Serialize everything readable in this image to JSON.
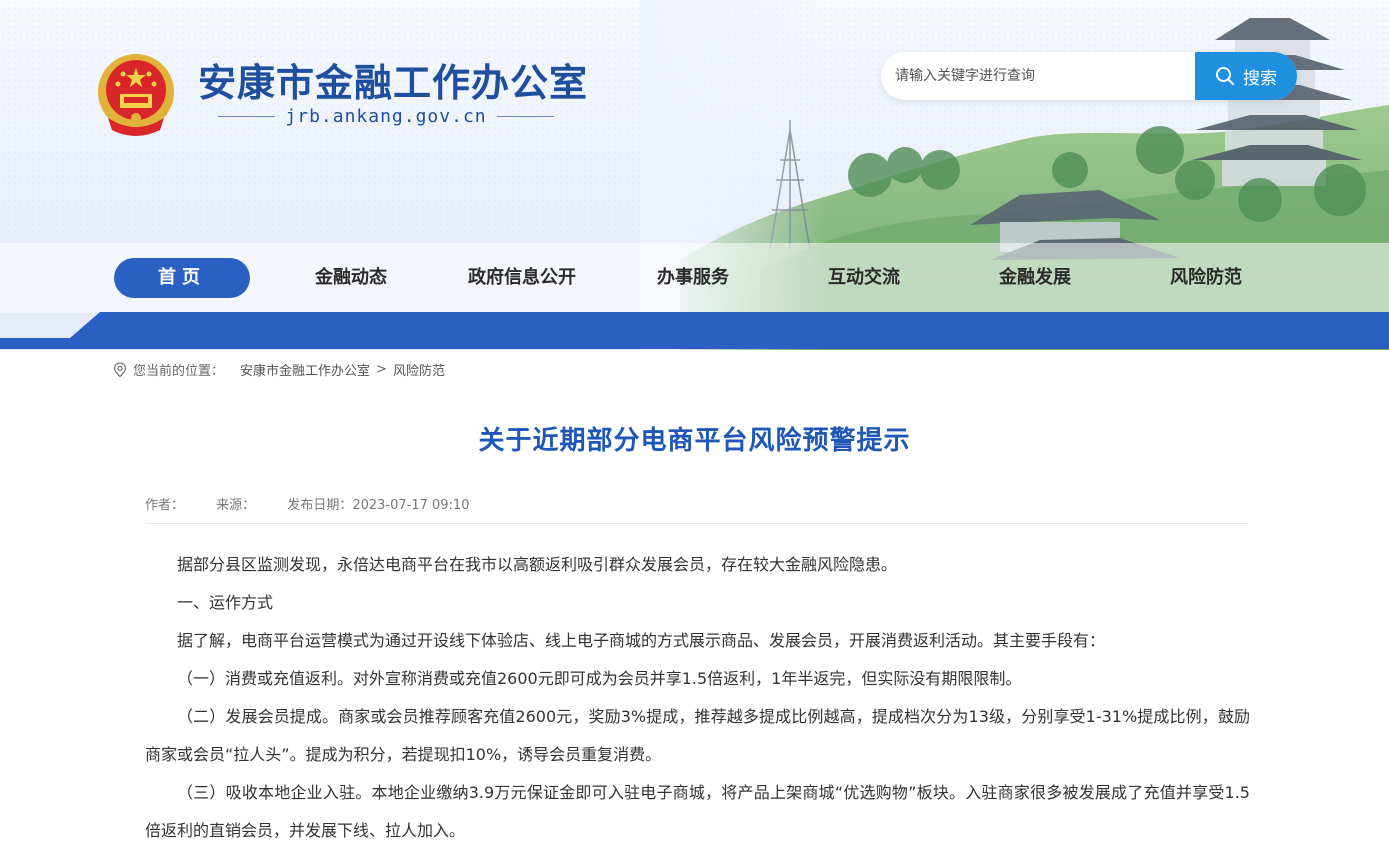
{
  "header": {
    "site_title": "安康市金融工作办公室",
    "site_domain": "jrb.ankang.gov.cn",
    "search": {
      "placeholder": "请输入关键字进行查询",
      "button_label": "搜索"
    }
  },
  "nav": {
    "items": [
      {
        "label": "首页",
        "active": true
      },
      {
        "label": "金融动态"
      },
      {
        "label": "政府信息公开"
      },
      {
        "label": "办事服务"
      },
      {
        "label": "互动交流"
      },
      {
        "label": "金融发展"
      },
      {
        "label": "风险防范"
      }
    ]
  },
  "breadcrumb": {
    "prefix": "您当前的位置：",
    "items": [
      "安康市金融工作办公室",
      "风险防范"
    ],
    "separator": ">"
  },
  "article": {
    "title": "关于近期部分电商平台风险预警提示",
    "meta": {
      "author": "作者：",
      "source": "来源：",
      "date": "发布日期：2023-07-17 09:10"
    },
    "paragraphs": [
      "据部分县区监测发现，永倍达电商平台在我市以高额返利吸引群众发展会员，存在较大金融风险隐患。",
      "一、运作方式",
      "据了解，电商平台运营模式为通过开设线下体验店、线上电子商城的方式展示商品、发展会员，开展消费返利活动。其主要手段有：",
      "（一）消费或充值返利。对外宣称消费或充值2600元即可成为会员并享1.5倍返利，1年半返完，但实际没有期限限制。",
      "（二）发展会员提成。商家或会员推荐顾客充值2600元，奖励3%提成，推荐越多提成比例越高，提成档次分为13级，分别享受1-31%提成比例，鼓励商家或会员“拉人头”。提成为积分，若提现扣10%，诱导会员重复消费。",
      "（三）吸收本地企业入驻。本地企业缴纳3.9万元保证金即可入驻电子商城，将产品上架商城“优选购物”板块。入驻商家很多被发展成了充值并享受1.5倍返利的直销会员，并发展下线、拉人加入。"
    ]
  },
  "colors": {
    "brand_blue": "#1d4f9e",
    "nav_active": "#2a5fc3",
    "band_blue": "#2a5fc3",
    "title_blue": "#1f57b8",
    "search_button": "#1f8fe0"
  },
  "icons": {
    "search_button_icon": "search-icon",
    "breadcrumb_icon": "location-pin-icon",
    "emblem": "national-emblem"
  }
}
